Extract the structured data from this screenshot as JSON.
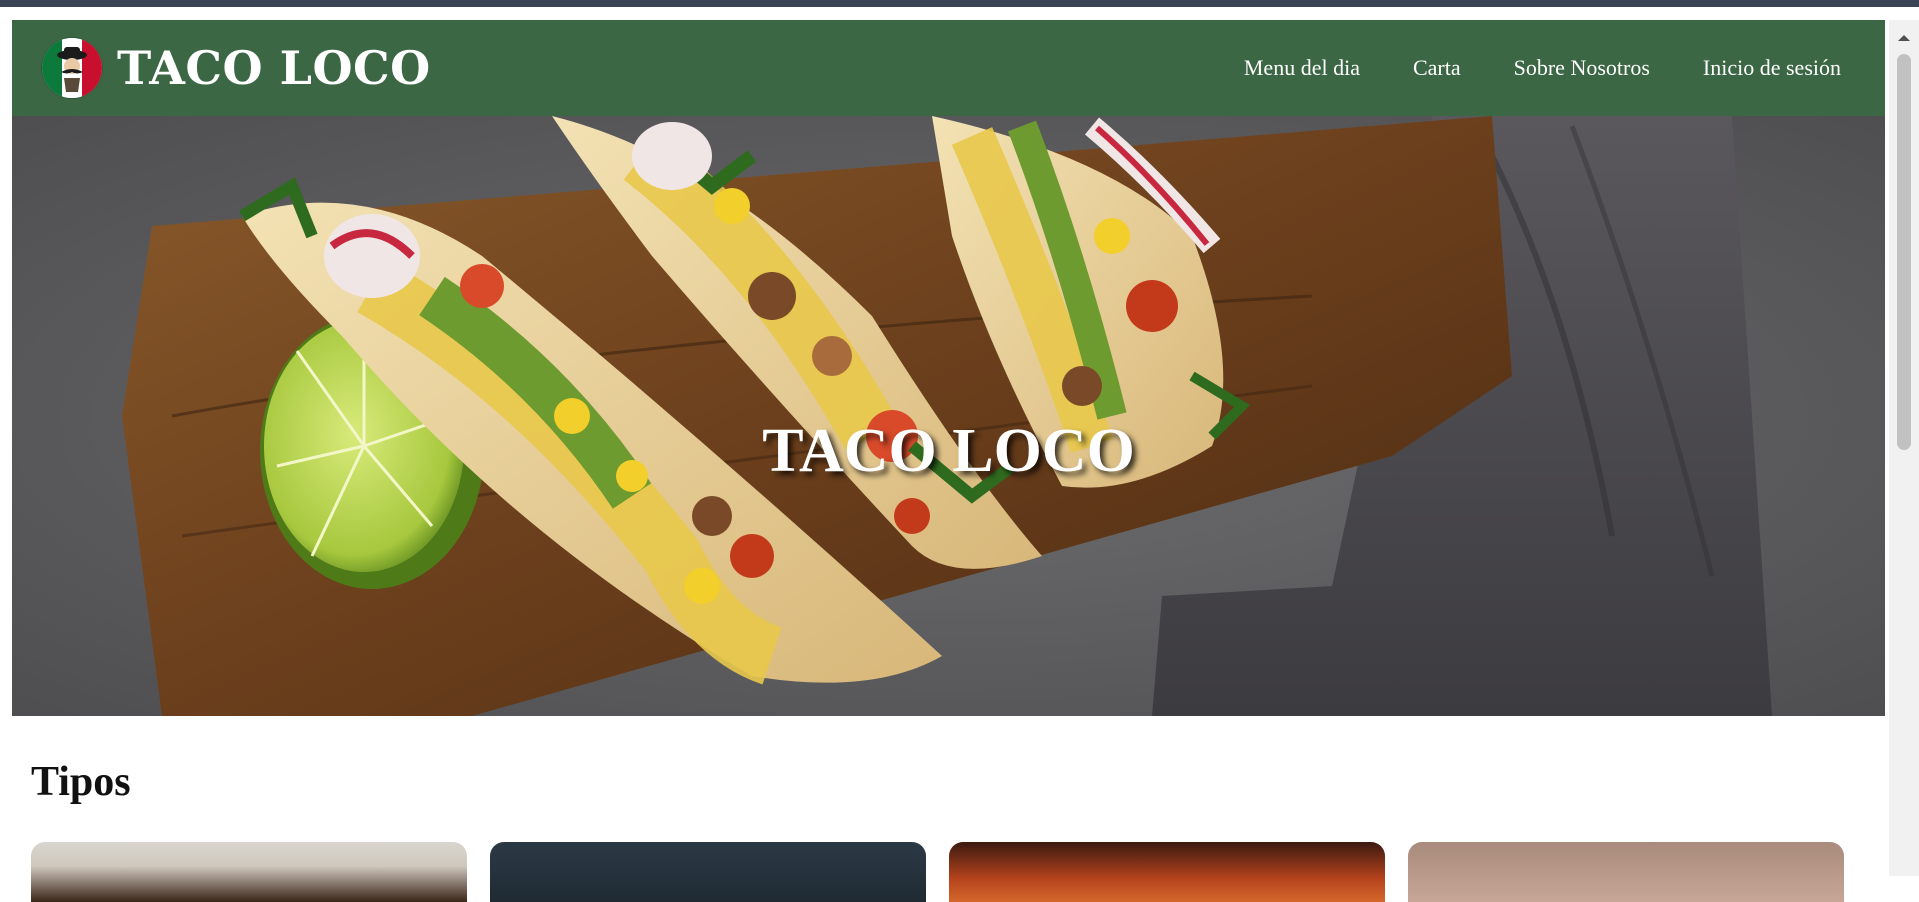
{
  "brand": {
    "name": "TACO LOCO",
    "logo_icon": "mexican-flag-mustache-logo"
  },
  "nav": {
    "items": [
      {
        "label": "Menu del dia"
      },
      {
        "label": "Carta"
      },
      {
        "label": "Sobre Nosotros"
      },
      {
        "label": "Inicio de sesión"
      }
    ]
  },
  "hero": {
    "title": "TACO LOCO"
  },
  "section": {
    "title": "Tipos",
    "cards": [
      {
        "name": "tipo-card-1"
      },
      {
        "name": "tipo-card-2"
      },
      {
        "name": "tipo-card-3"
      },
      {
        "name": "tipo-card-4"
      }
    ]
  },
  "colors": {
    "navbar": "#3b6744",
    "accent_text": "#ffffff",
    "background": "#ffffff"
  }
}
